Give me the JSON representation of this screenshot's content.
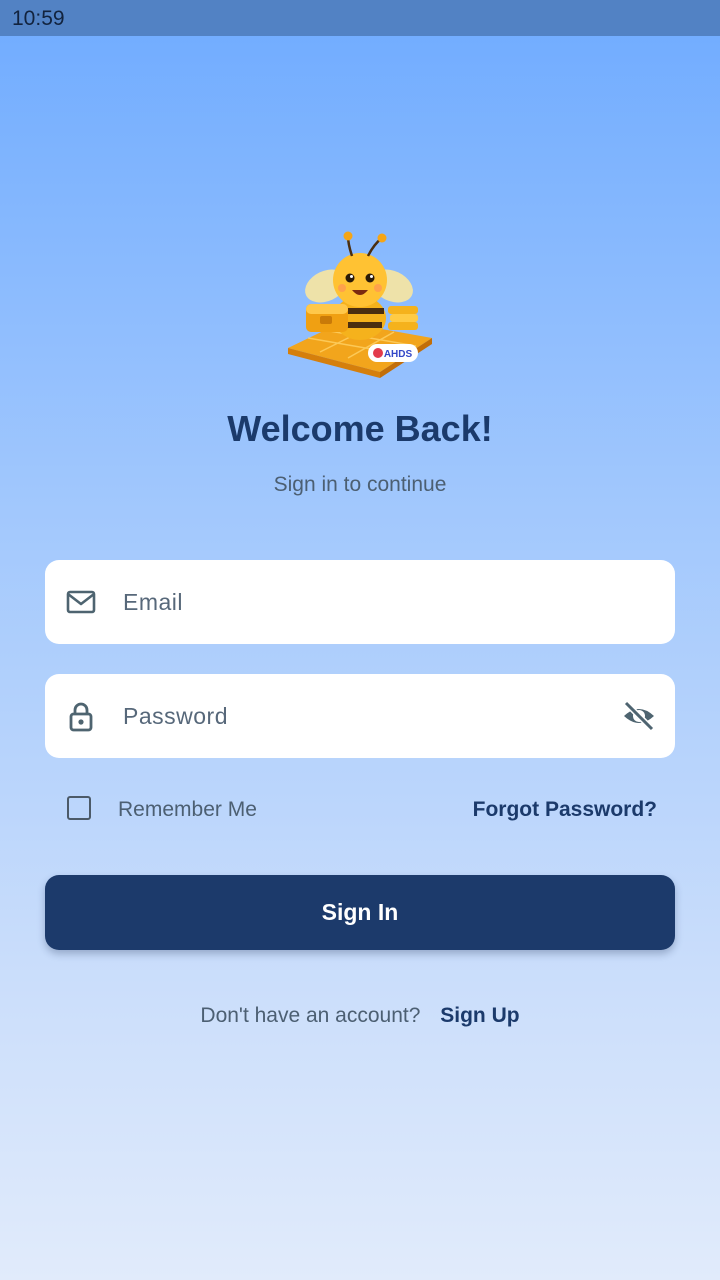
{
  "status_bar": {
    "time": "10:59"
  },
  "logo": {
    "name": "bee-mascot-logo",
    "badge_text": "AHDS"
  },
  "header": {
    "title": "Welcome Back!",
    "subtitle": "Sign in to continue"
  },
  "form": {
    "email": {
      "placeholder": "Email",
      "value": "",
      "icon": "mail-icon"
    },
    "password": {
      "placeholder": "Password",
      "value": "",
      "icon": "lock-icon",
      "toggle_icon": "eye-off-icon"
    },
    "remember_me": {
      "label": "Remember Me",
      "checked": false
    },
    "forgot_password": "Forgot Password?",
    "submit_label": "Sign In"
  },
  "footer": {
    "prompt": "Don't have an account?",
    "signup_label": "Sign Up"
  },
  "colors": {
    "primary": "#1c3a6b",
    "status_bar": "#5282c4",
    "gradient_top": "#6fabff",
    "gradient_bottom": "#e1ebfb"
  }
}
